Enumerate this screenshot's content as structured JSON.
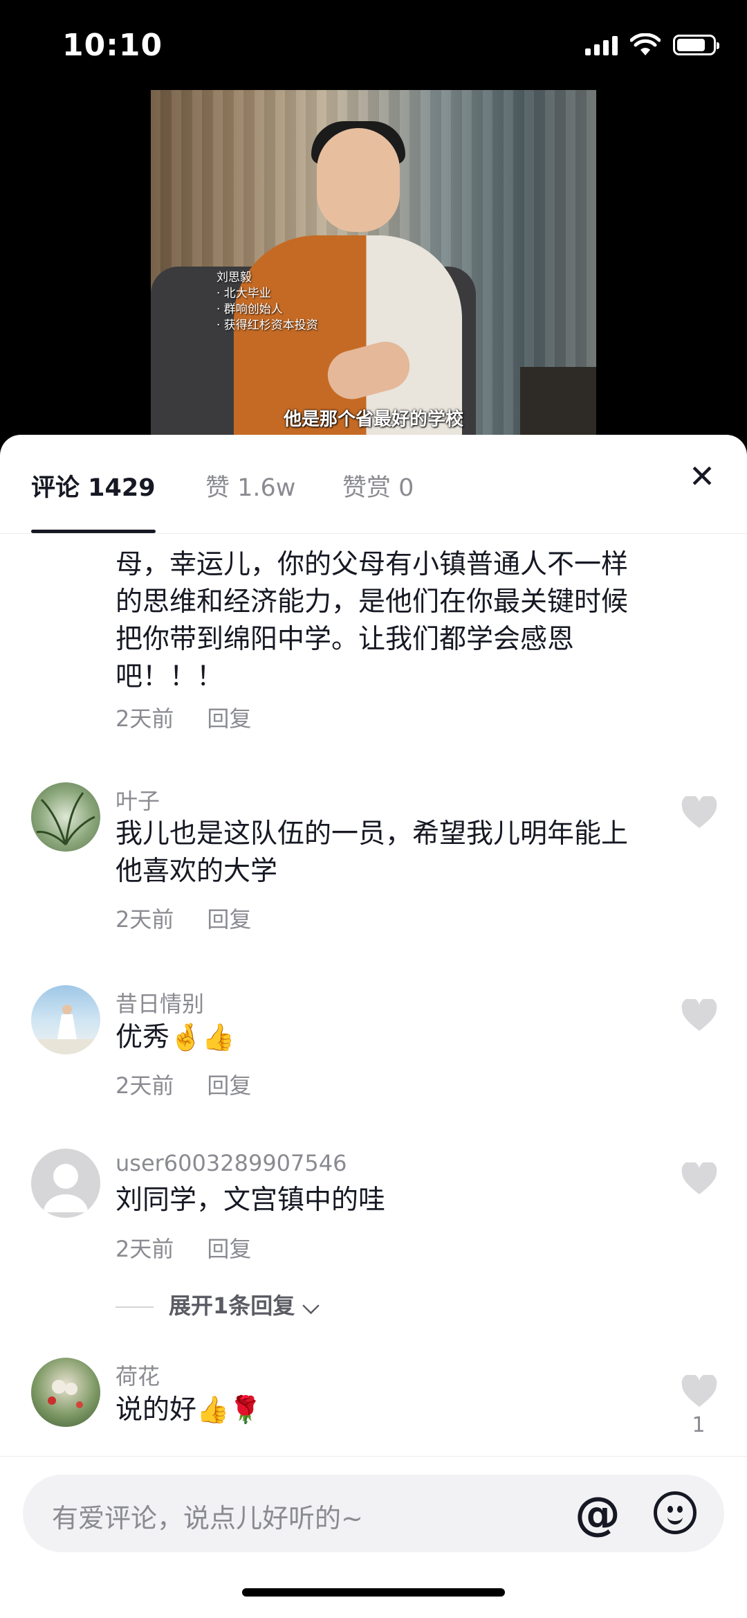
{
  "status_bar": {
    "time": "10:10"
  },
  "video": {
    "name_card": [
      "刘思毅",
      "· 北大毕业",
      "· 群响创始人",
      "· 获得红杉资本投资"
    ],
    "subtitle": "他是那个省最好的学校"
  },
  "tabs": [
    {
      "label": "评论 1429",
      "active": true
    },
    {
      "label": "赞 1.6w",
      "active": false
    },
    {
      "label": "赞赏 0",
      "active": false
    }
  ],
  "comments": [
    {
      "text": "母，幸运儿，你的父母有小镇普通人不一样的思维和经济能力，是他们在你最关键时候把你带到绵阳中学。让我们都学会感恩吧！！！",
      "time": "2天前",
      "reply": "回复"
    },
    {
      "user": "叶子",
      "text": "我儿也是这队伍的一员，希望我儿明年能上他喜欢的大学",
      "time": "2天前",
      "reply": "回复"
    },
    {
      "user": "昔日情别",
      "text": "优秀",
      "emoji": "🤞👍",
      "time": "2天前",
      "reply": "回复"
    },
    {
      "user": "user6003289907546",
      "text": "刘同学，文宫镇中的哇",
      "time": "2天前",
      "reply": "回复",
      "expand": "展开1条回复"
    },
    {
      "user": "荷花",
      "text": "说的好",
      "emoji": "👍🌹",
      "likes": "1"
    }
  ],
  "input": {
    "placeholder": "有爱评论，说点儿好听的~",
    "at_symbol": "@"
  },
  "colors": {
    "text": "#161823",
    "muted": "#8a8b91",
    "sheet_bg": "#ffffff"
  }
}
